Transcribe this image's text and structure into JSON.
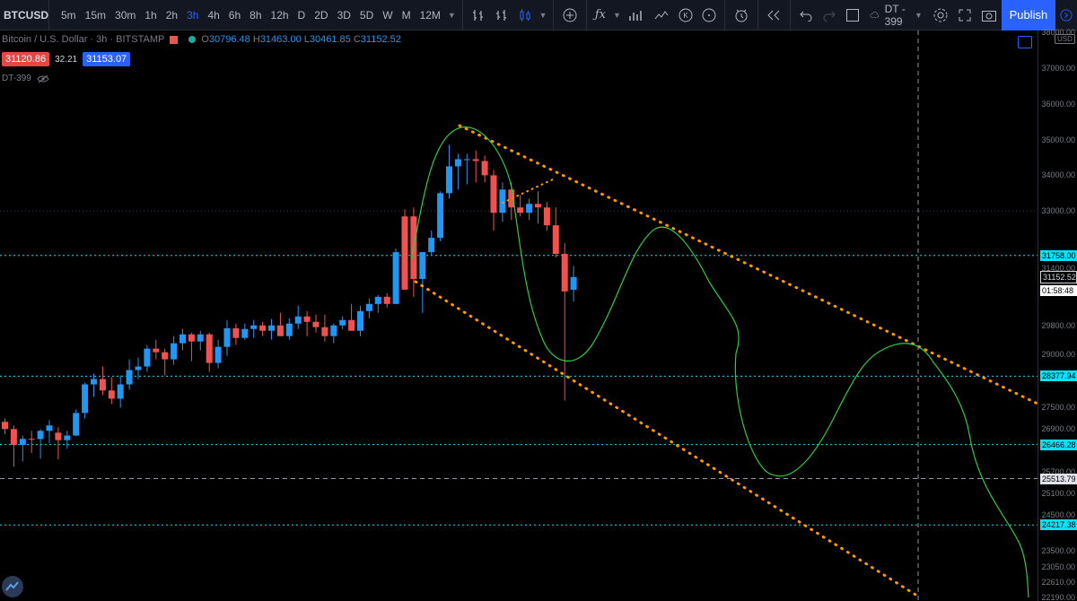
{
  "toolbar": {
    "symbol": "BTCUSD",
    "timeframes": [
      "5m",
      "15m",
      "30m",
      "1h",
      "2h",
      "3h",
      "4h",
      "6h",
      "8h",
      "12h",
      "D",
      "2D",
      "3D",
      "5D",
      "W",
      "M",
      "12M"
    ],
    "active_timeframe": "3h",
    "layout_name": "DT - 399",
    "publish_label": "Publish",
    "icons": [
      "bar-style-icon",
      "candle-style-icon",
      "indicators-icon",
      "fx-icon",
      "compare-icon",
      "replay-icon",
      "undo-icon",
      "redo-icon",
      "settings-icon",
      "fullscreen-icon",
      "camera-icon"
    ]
  },
  "legend": {
    "title": "Bitcoin / U.S. Dollar · 3h · BITSTAMP",
    "open_label": "O",
    "open": "30796.48",
    "high_label": "H",
    "high": "31463.00",
    "low_label": "L",
    "low": "30461.85",
    "close_label": "C",
    "close": "31152.52",
    "bid": "31120.86",
    "spread": "32.21",
    "ask": "31153.07",
    "indicator": "DT-399"
  },
  "scale": {
    "currency": "USD",
    "ticks": [
      "38000.00",
      "37000.00",
      "36000.00",
      "35000.00",
      "34000.00",
      "33000.00",
      "31400.00",
      "29800.00",
      "29000.00",
      "27500.00",
      "26900.00",
      "25700.00",
      "25100.00",
      "24500.00",
      "23500.00",
      "23050.00",
      "22610.00",
      "22190.00"
    ],
    "levels": {
      "l1": "31758.00",
      "price": "31152.52",
      "countdown": "01:58:48",
      "l2": "28377.94",
      "l3": "26466.28",
      "crosshair": "25513.79",
      "l4": "24217.38"
    }
  },
  "colors": {
    "up": "#2196f3",
    "down": "#ef5350",
    "trend": "#ff9800",
    "level": "#00e5ff",
    "path": "#2ecc40"
  },
  "chart_data": {
    "type": "candlestick",
    "symbol": "BTCUSD",
    "ohlc": [
      [
        27102,
        27200,
        26750,
        26900
      ],
      [
        26900,
        27000,
        25850,
        26455
      ],
      [
        26455,
        26720,
        26000,
        26625
      ],
      [
        26625,
        26850,
        26230,
        26620
      ],
      [
        26620,
        26900,
        26070,
        26850
      ],
      [
        26850,
        27150,
        26500,
        27000
      ],
      [
        26800,
        26950,
        26050,
        26590
      ],
      [
        26590,
        26850,
        26350,
        26720
      ],
      [
        26720,
        27450,
        26700,
        27350
      ],
      [
        27350,
        28200,
        27200,
        28150
      ],
      [
        28150,
        28450,
        27800,
        28300
      ],
      [
        28300,
        28650,
        27850,
        27980
      ],
      [
        27980,
        28350,
        27600,
        27750
      ],
      [
        27750,
        28400,
        27500,
        28150
      ],
      [
        28150,
        28850,
        28000,
        28550
      ],
      [
        28550,
        28900,
        28300,
        28650
      ],
      [
        28650,
        29250,
        28500,
        29150
      ],
      [
        29150,
        29400,
        28850,
        29050
      ],
      [
        29050,
        29150,
        28400,
        28850
      ],
      [
        28850,
        29500,
        28700,
        29300
      ],
      [
        29300,
        29700,
        29100,
        29550
      ],
      [
        29550,
        29600,
        28800,
        29350
      ],
      [
        29350,
        29650,
        29100,
        29550
      ],
      [
        29550,
        29600,
        28500,
        28750
      ],
      [
        28750,
        29400,
        28600,
        29200
      ],
      [
        29200,
        29950,
        28950,
        29720
      ],
      [
        29720,
        29850,
        29250,
        29450
      ],
      [
        29450,
        29850,
        29400,
        29700
      ],
      [
        29700,
        29950,
        29450,
        29800
      ],
      [
        29800,
        29900,
        29500,
        29650
      ],
      [
        29650,
        29980,
        29400,
        29800
      ],
      [
        29800,
        30150,
        29500,
        29500
      ],
      [
        29500,
        30000,
        29400,
        29850
      ],
      [
        29850,
        30350,
        29700,
        30050
      ],
      [
        30050,
        30200,
        29500,
        29900
      ],
      [
        29900,
        30100,
        29600,
        29750
      ],
      [
        29750,
        30100,
        29350,
        29500
      ],
      [
        29500,
        29850,
        29300,
        29800
      ],
      [
        29800,
        30050,
        29700,
        29950
      ],
      [
        29950,
        30400,
        29650,
        29650
      ],
      [
        29650,
        30350,
        29500,
        30200
      ],
      [
        30200,
        30550,
        30000,
        30400
      ],
      [
        30400,
        30650,
        30150,
        30600
      ],
      [
        30600,
        30700,
        30300,
        30400
      ],
      [
        30400,
        31950,
        30400,
        31850
      ],
      [
        32850,
        33050,
        30800,
        30800
      ],
      [
        32850,
        33100,
        30600,
        31100
      ],
      [
        31100,
        31850,
        30150,
        31850
      ],
      [
        31850,
        32450,
        31750,
        32250
      ],
      [
        32250,
        33550,
        32150,
        33500
      ],
      [
        33500,
        34850,
        33350,
        34250
      ],
      [
        34250,
        34600,
        33600,
        34450
      ],
      [
        34450,
        34600,
        33750,
        34450
      ],
      [
        34450,
        34700,
        33800,
        34400
      ],
      [
        34400,
        34550,
        33800,
        34000
      ],
      [
        34000,
        34150,
        32450,
        32950
      ],
      [
        32950,
        33800,
        32700,
        33600
      ],
      [
        33600,
        33800,
        32750,
        33100
      ],
      [
        33100,
        33450,
        32850,
        32950
      ],
      [
        32950,
        33350,
        32750,
        33200
      ],
      [
        33200,
        33550,
        32650,
        33100
      ],
      [
        33100,
        33250,
        32450,
        32600
      ],
      [
        32600,
        33100,
        31700,
        31800
      ],
      [
        31800,
        32100,
        27700,
        30750
      ],
      [
        30796.48,
        31463,
        30461.85,
        31152.52
      ]
    ],
    "levels": [
      31758,
      28377.94,
      26466.28,
      24217.38
    ],
    "crosshair_price": 25513.79,
    "y_range": [
      22190,
      38000
    ]
  }
}
